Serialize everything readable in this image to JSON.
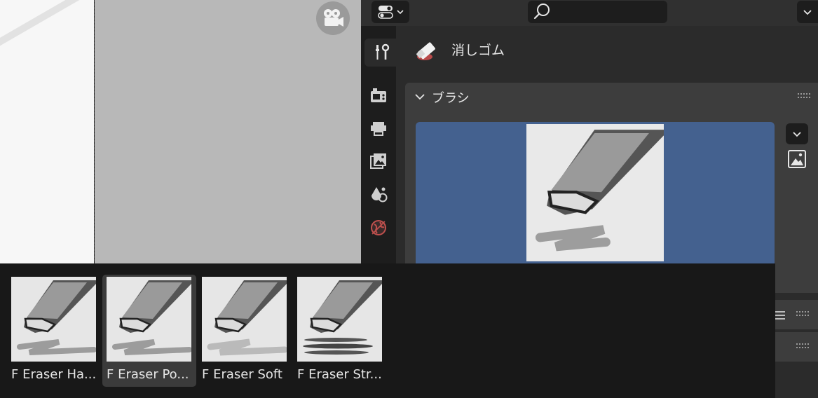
{
  "header": {
    "editor_type_icon": "toggles-icon",
    "search_placeholder": "",
    "options_icon": "chevron-down-icon"
  },
  "tabs": [
    {
      "name": "tool",
      "icon": "wrench-screwdriver-icon",
      "active": true
    },
    {
      "name": "render",
      "icon": "camera-back-icon",
      "active": false
    },
    {
      "name": "output",
      "icon": "printer-icon",
      "active": false
    },
    {
      "name": "view-layer",
      "icon": "image-stack-icon",
      "active": false
    },
    {
      "name": "scene",
      "icon": "scene-shapes-icon",
      "active": false
    },
    {
      "name": "world",
      "icon": "world-icon",
      "active": false
    }
  ],
  "tool": {
    "name": "消しゴム",
    "icon": "eraser-icon"
  },
  "brush_panel": {
    "title": "ブラシ"
  },
  "brush_list": [
    {
      "label": "F Eraser Ha...",
      "selected": false,
      "variant": "hard"
    },
    {
      "label": "F Eraser Po...",
      "selected": true,
      "variant": "point"
    },
    {
      "label": "F Eraser Soft",
      "selected": false,
      "variant": "soft"
    },
    {
      "label": "F Eraser Str...",
      "selected": false,
      "variant": "stroke"
    }
  ],
  "colors": {
    "accent": "#44618f",
    "panel": "#3d3d3d",
    "background": "#2b2b2b",
    "popup": "#181818"
  }
}
